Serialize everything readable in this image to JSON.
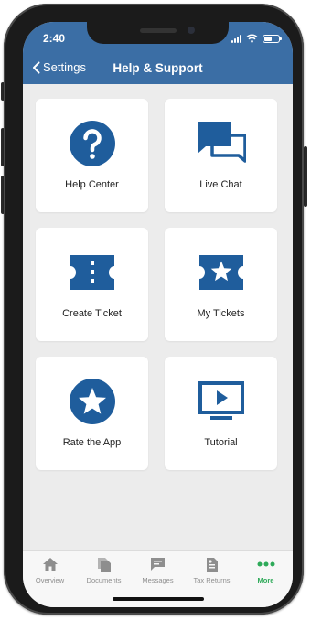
{
  "status_bar": {
    "time": "2:40",
    "battery_level": 0.55
  },
  "nav": {
    "back_label": "Settings",
    "title": "Help & Support"
  },
  "tiles": [
    {
      "label": "Help Center",
      "icon": "help-circle-icon"
    },
    {
      "label": "Live Chat",
      "icon": "chat-bubbles-icon"
    },
    {
      "label": "Create Ticket",
      "icon": "ticket-icon"
    },
    {
      "label": "My Tickets",
      "icon": "star-ticket-icon"
    },
    {
      "label": "Rate the App",
      "icon": "star-circle-icon"
    },
    {
      "label": "Tutorial",
      "icon": "play-screen-icon"
    }
  ],
  "tabbar": {
    "items": [
      {
        "label": "Overview",
        "icon": "home-icon"
      },
      {
        "label": "Documents",
        "icon": "documents-icon"
      },
      {
        "label": "Messages",
        "icon": "message-icon"
      },
      {
        "label": "Tax Returns",
        "icon": "tax-returns-icon"
      },
      {
        "label": "More",
        "icon": "more-dots-icon"
      }
    ],
    "active_index": 4
  },
  "colors": {
    "header": "#3b6ea5",
    "icon_blue": "#1f5d9c",
    "active_tab": "#2eaa59",
    "inactive_tab": "#8e8e8e",
    "background": "#ececec"
  }
}
